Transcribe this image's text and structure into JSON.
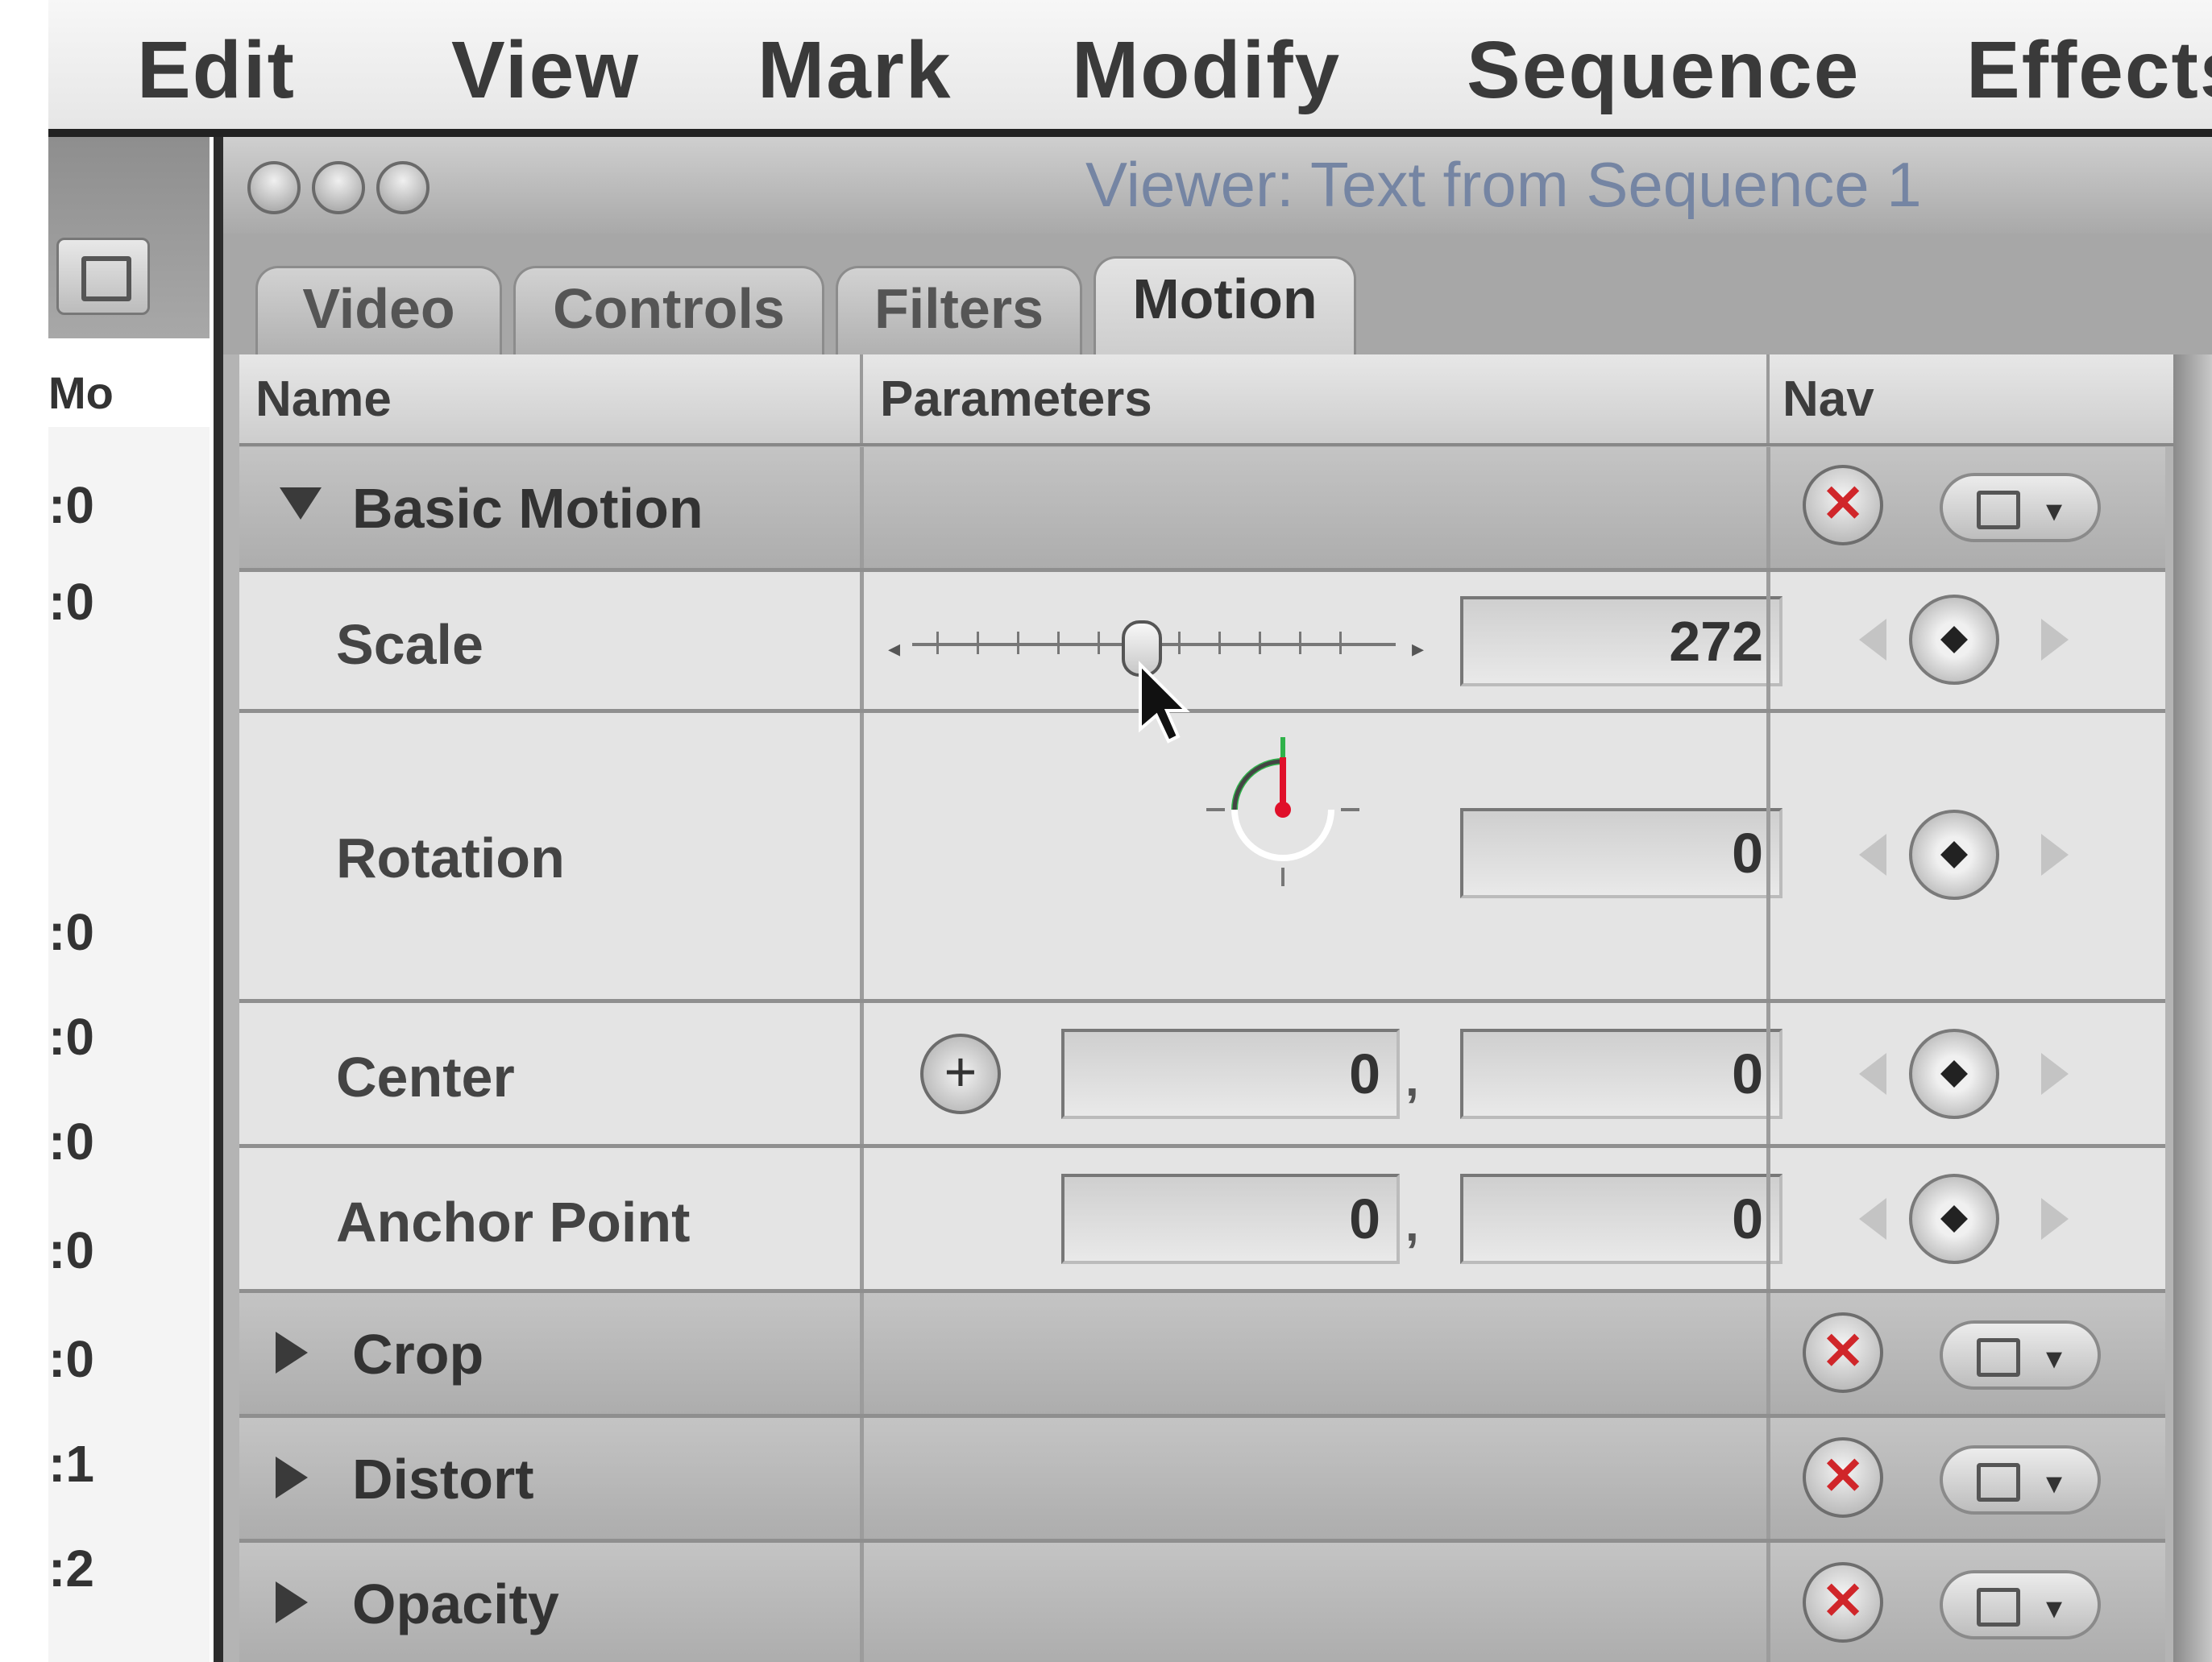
{
  "menubar": {
    "items": [
      "Edit",
      "View",
      "Mark",
      "Modify",
      "Sequence",
      "Effects"
    ]
  },
  "left_strip": {
    "header": "Mo",
    "timecodes": [
      ":0",
      ":0",
      ":0",
      ":0",
      ":0",
      ":0",
      ":0",
      ":1",
      ":2"
    ]
  },
  "viewer": {
    "title": "Viewer: Text from Sequence 1",
    "tabs": [
      {
        "label": "Video",
        "active": false
      },
      {
        "label": "Controls",
        "active": false
      },
      {
        "label": "Filters",
        "active": false
      },
      {
        "label": "Motion",
        "active": true
      }
    ],
    "columns": {
      "name": "Name",
      "parameters": "Parameters",
      "nav": "Nav"
    },
    "basic_motion": {
      "label": "Basic Motion",
      "expanded": true,
      "scale": {
        "label": "Scale",
        "value": "272"
      },
      "rotation": {
        "label": "Rotation",
        "value": "0"
      },
      "center": {
        "label": "Center",
        "x": "0",
        "y": "0"
      },
      "anchor_point": {
        "label": "Anchor Point",
        "x": "0",
        "y": "0"
      }
    },
    "groups": [
      {
        "label": "Crop",
        "expanded": false
      },
      {
        "label": "Distort",
        "expanded": false
      },
      {
        "label": "Opacity",
        "expanded": false
      }
    ],
    "comma": ","
  },
  "colors": {
    "reset_x": "#d0262a",
    "rotation_needle": "#e0102a",
    "rotation_green": "#2fb24a",
    "title_text": "#7585a3"
  },
  "icons": {
    "reset": "reset-x-icon",
    "menu": "checkbox-menu-icon",
    "keyframe_nav": "keyframe-diamond-icon",
    "center_target": "crosshair-icon",
    "disclosure_open": "triangle-down-icon",
    "disclosure_closed": "triangle-right-icon"
  }
}
